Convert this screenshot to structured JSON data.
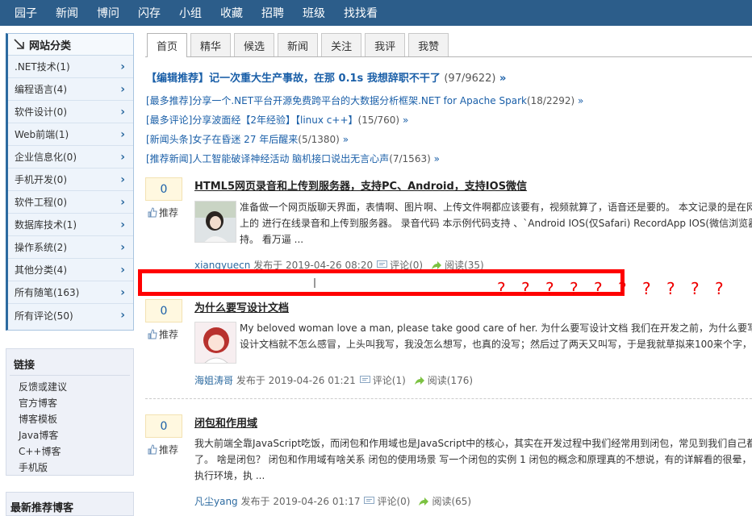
{
  "nav": [
    "园子",
    "新闻",
    "博问",
    "闪存",
    "小组",
    "收藏",
    "招聘",
    "班级",
    "找找看"
  ],
  "sidebar": {
    "title": "网站分类",
    "categories": [
      ".NET技术(1)",
      "编程语言(4)",
      "软件设计(0)",
      "Web前端(1)",
      "企业信息化(0)",
      "手机开发(0)",
      "软件工程(0)",
      "数据库技术(1)",
      "操作系统(2)",
      "其他分类(4)",
      "所有随笔(163)",
      "所有评论(50)"
    ],
    "links_title": "链接",
    "links": [
      "反馈或建议",
      "官方博客",
      "博客模板",
      "Java博客",
      "C++博客",
      "手机版"
    ],
    "recommend_title": "最新推荐博客"
  },
  "tabs": [
    "首页",
    "精华",
    "候选",
    "新闻",
    "关注",
    "我评",
    "我赞"
  ],
  "headline_main": {
    "text": "【编辑推荐】记一次重大生产事故，在那 0.1s 我想辞职不干了",
    "count": "(97/9622)",
    "arrow": "»"
  },
  "headlines": [
    {
      "text": "[最多推荐]分享一个.NET平台开源免费跨平台的大数据分析框架.NET for Apache Spark",
      "count": "(18/2292)",
      "arrow": "»"
    },
    {
      "text": "[最多评论]分享波面经【2年经验】【linux c++】",
      "count": "(15/760)",
      "arrow": "»"
    },
    {
      "text": "[新闻头条]女子在昏迷 27 年后醒来",
      "count": "(5/1380)",
      "arrow": "»"
    },
    {
      "text": "[推荐新闻]人工智能破译神经活动 脑机接口说出无言心声",
      "count": "(7/1563)",
      "arrow": "»"
    }
  ],
  "posts": [
    {
      "votes": "0",
      "digg": "推荐",
      "title": "HTML5网页录音和上传到服务器，支持PC、Android，支持IOS微信",
      "summary": [
        "准备做一个网页版聊天界面，表情啊、图片啊、上传文件啊都应该要有，视频就算了，语音还是要的。 本文记录的是在网",
        "上的 进行在线录音和上传到服务器。 录音代码 本示例代码支持 、`Android IOS(仅Safari) RecordApp IOS(微信浏览器、",
        "持。 看万逼 ..."
      ],
      "author": "xiangyuecn",
      "posted": "发布于 2019-04-26 08:20",
      "comments": "评论(0)",
      "reads": "阅读(35)"
    },
    {
      "votes": "0",
      "digg": "推荐",
      "title": "为什么要写设计文档",
      "summary": [
        "My beloved woman love a man, please take good care of her. 为什么要写设计文档 我们在开发之前，为什么要写设计文",
        "设计文档就不怎么感冒，上头叫我写，我没怎么想写，也真的没写；然后过了两天又叫写，于是我就草拟来100来个字，"
      ],
      "author": "海姐涛哥",
      "posted": "发布于 2019-04-26 01:21",
      "comments": "评论(1)",
      "reads": "阅读(176)"
    },
    {
      "votes": "0",
      "digg": "推荐",
      "title": "闭包和作用域",
      "summary": [
        "我大前端全靠JavaScript吃饭，而闭包和作用域也是JavaScript中的核心，其实在开发过程中我们经常用到闭包，常见到我们自己都不",
        "了。 啥是闭包？ 闭包和作用域有啥关系 闭包的使用场景 写一个闭包的实例 1 闭包的概念和原理真的不想说，有的详解看的很晕，看",
        "执行环境，执 ..."
      ],
      "author": "凡尘yang",
      "posted": "发布于 2019-04-26 01:17",
      "comments": "评论(0)",
      "reads": "阅读(65)"
    }
  ],
  "overlay": {
    "marks": [
      "?",
      "?",
      "?",
      "?",
      "?",
      "?",
      "?",
      "?",
      "?",
      "?"
    ],
    "color": "#ff0000"
  },
  "colors": {
    "nav_bg": "#2c5d8a",
    "link_blue": "#1a5fa8"
  }
}
